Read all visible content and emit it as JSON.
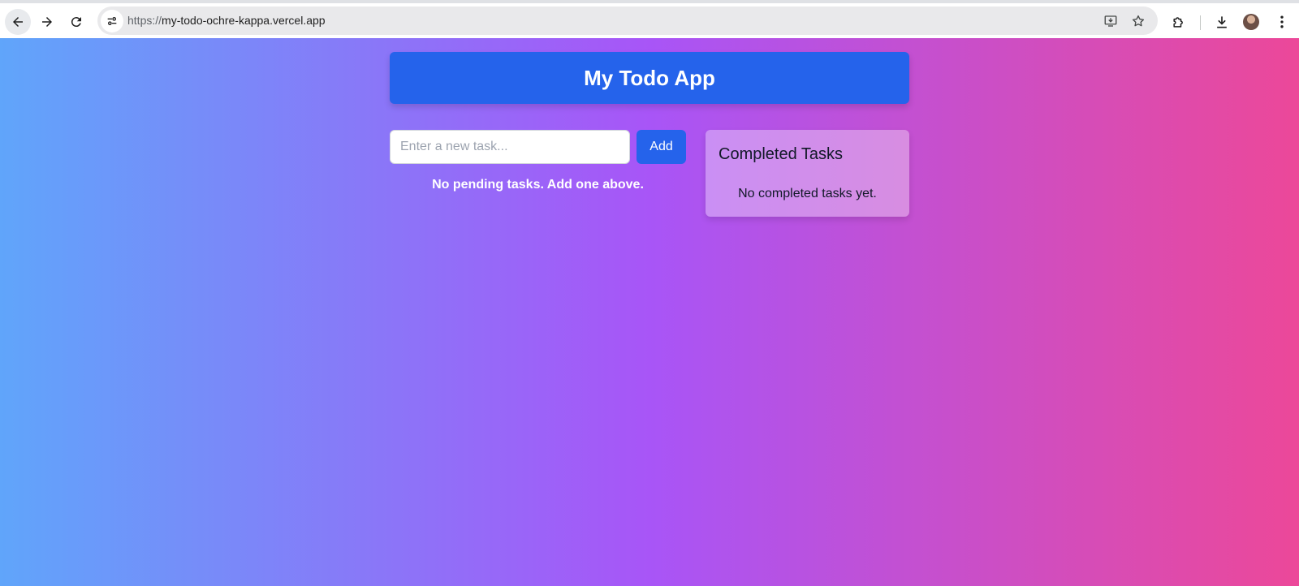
{
  "browser": {
    "url_scheme": "https://",
    "url_host": "my-todo-ochre-kappa.vercel.app",
    "icons": {
      "back": "back-arrow-icon",
      "forward": "forward-arrow-icon",
      "reload": "reload-icon",
      "site_info": "site-info-icon",
      "install": "install-app-icon",
      "star": "bookmark-star-icon",
      "extensions": "extensions-puzzle-icon",
      "downloads": "download-icon",
      "menu": "kebab-menu-icon"
    }
  },
  "app": {
    "title": "My Todo App",
    "task_input_placeholder": "Enter a new task...",
    "add_label": "Add",
    "no_pending_text": "No pending tasks. Add one above.",
    "completed": {
      "heading": "Completed Tasks",
      "empty_text": "No completed tasks yet."
    }
  },
  "colors": {
    "gradient_start": "#60a5fa",
    "gradient_mid": "#a855f7",
    "gradient_end": "#ec4899",
    "primary": "#2563eb"
  }
}
